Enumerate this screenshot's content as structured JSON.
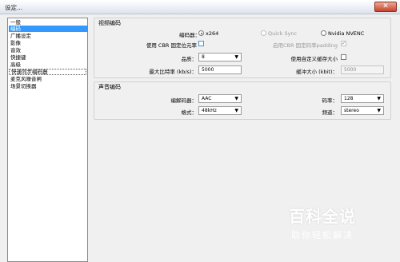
{
  "window": {
    "title": "设定..."
  },
  "sidebar": {
    "items": [
      {
        "label": "一般"
      },
      {
        "label": "编码"
      },
      {
        "label": "广播设定"
      },
      {
        "label": "影像"
      },
      {
        "label": "音效"
      },
      {
        "label": "快捷键"
      },
      {
        "label": "高级"
      },
      {
        "label": "快速同步编码器"
      },
      {
        "label": "麦克风噪音闸"
      },
      {
        "label": "场景切换器"
      }
    ],
    "selected": "编码"
  },
  "video": {
    "title": "视频编码",
    "encoder_label": "编码器：",
    "encoder_options": [
      "x264",
      "Quick Sync",
      "Nvidia NVENC"
    ],
    "encoder_selected": "x264",
    "cbr_label": "使用 CBR 固定位元率",
    "cbr_padding_label": "启用CBR 固定码率padding",
    "quality_label": "品质：",
    "quality_value": "8",
    "custom_buffer_label": "使用自定义缓存大小",
    "max_bitrate_label": "最大比特率 (kb/s)：",
    "max_bitrate_value": "5000",
    "buffer_size_label": "缓冲大小 (kbit)：",
    "buffer_size_value": "5000"
  },
  "audio": {
    "title": "声音编码",
    "codec_label": "编解码器：",
    "codec_value": "AAC",
    "bitrate_label": "码率：",
    "bitrate_value": "128",
    "format_label": "格式：",
    "format_value": "48kHz",
    "channels_label": "频道：",
    "channels_value": "stereo"
  },
  "watermark": {
    "main": "百科全说",
    "sub": "助你轻松解决"
  },
  "colors": {
    "selection": "#3399ff",
    "close_button": "#c8432b"
  }
}
